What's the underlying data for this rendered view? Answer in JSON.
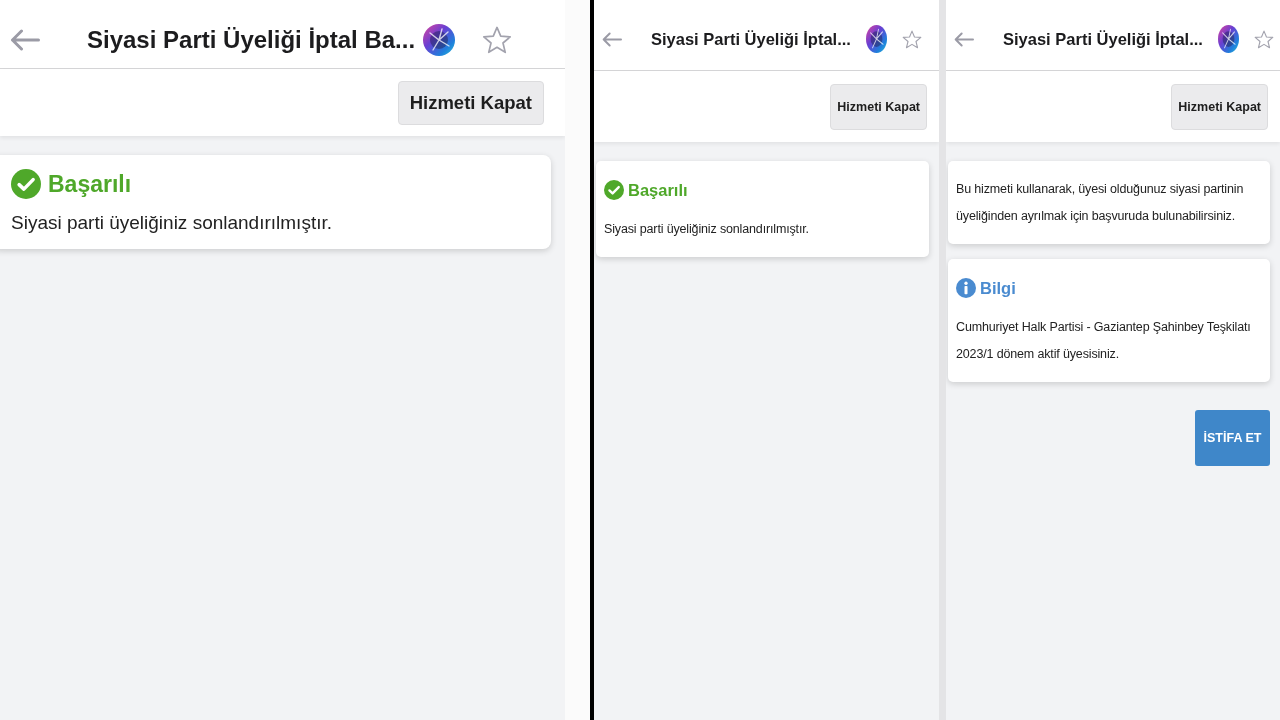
{
  "panels": [
    {
      "header": {
        "title": "Siyasi Parti Üyeliği İptal Ba..."
      },
      "toolbar": {
        "button": "Hizmeti Kapat"
      },
      "cards": [
        {
          "kind": "success",
          "title": "Başarılı",
          "text": "Siyasi parti üyeliğiniz sonlandırılmıştır."
        }
      ]
    },
    {
      "header": {
        "title": "Siyasi Parti Üyeliği İptal..."
      },
      "toolbar": {
        "button": "Hizmeti Kapat"
      },
      "cards": [
        {
          "kind": "success",
          "title": "Başarılı",
          "text": "Siyasi parti üyeliğiniz sonlandırılmıştır."
        }
      ]
    },
    {
      "header": {
        "title": "Siyasi Parti Üyeliği İptal..."
      },
      "toolbar": {
        "button": "Hizmeti Kapat"
      },
      "cards": [
        {
          "kind": "note",
          "text": "Bu hizmeti kullanarak, üyesi olduğunuz siyasi partinin üyeliğinden ayrılmak için başvuruda bulunabilirsiniz."
        },
        {
          "kind": "info",
          "title": "Bilgi",
          "text": "Cumhuriyet Halk Partisi - Gaziantep Şahinbey Teşkilatı 2023/1 dönem aktif üyesisiniz."
        }
      ],
      "action": {
        "label": "İSTİFA ET"
      }
    }
  ]
}
